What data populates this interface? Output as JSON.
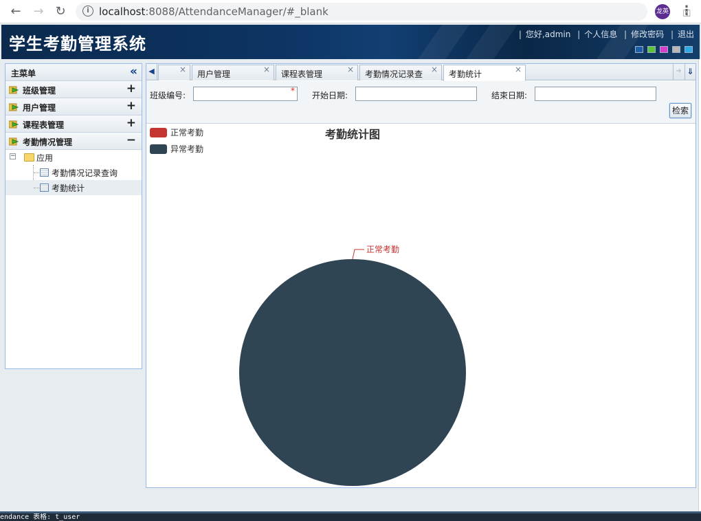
{
  "browser": {
    "url_host": "localhost",
    "url_rest": ":8088/AttendanceManager/#_blank",
    "profile_initials": "龙英"
  },
  "header": {
    "app_title": "学生考勤管理系统",
    "links": {
      "greeting": "您好,admin",
      "profile": "个人信息",
      "change_password": "修改密码",
      "logout": "退出"
    },
    "theme_colors": [
      "#1f5fa8",
      "#5cc43a",
      "#d63ccf",
      "#b8b8b8",
      "#2fa9e6"
    ]
  },
  "sidebar": {
    "title": "主菜单",
    "groups": [
      {
        "label": "班级管理",
        "toggle": "+"
      },
      {
        "label": "用户管理",
        "toggle": "+"
      },
      {
        "label": "课程表管理",
        "toggle": "+"
      },
      {
        "label": "考勤情况管理",
        "toggle": "−"
      }
    ],
    "tree": {
      "root": "应用",
      "children": [
        {
          "label": "考勤情况记录查询"
        },
        {
          "label": "考勤统计",
          "selected": true
        }
      ]
    }
  },
  "tabs": [
    {
      "label": "",
      "close": "×"
    },
    {
      "label": "用户管理",
      "close": "×"
    },
    {
      "label": "课程表管理",
      "close": "×"
    },
    {
      "label": "考勤情况记录查",
      "close": "×"
    },
    {
      "label": "考勤统计",
      "close": "×",
      "active": true
    }
  ],
  "filters": {
    "class_no_label": "班级编号:",
    "class_no_value": "",
    "required_mark": "*",
    "start_date_label": "开始日期:",
    "start_date_value": "",
    "end_date_label": "结束日期:",
    "end_date_value": "",
    "search_button": "检索"
  },
  "chart_data": {
    "type": "pie",
    "title": "考勤统计图",
    "legend": [
      {
        "name": "正常考勤",
        "color": "#c23531"
      },
      {
        "name": "异常考勤",
        "color": "#2f4554"
      }
    ],
    "legend_position": "top-left",
    "series": [
      {
        "name": "正常考勤",
        "value": 0,
        "color": "#c23531"
      },
      {
        "name": "异常考勤",
        "value": 1,
        "color": "#2f4554"
      }
    ],
    "slice_labels": [
      "正常考勤"
    ]
  },
  "status_bar": {
    "text": "endance  表格:  t_user"
  }
}
